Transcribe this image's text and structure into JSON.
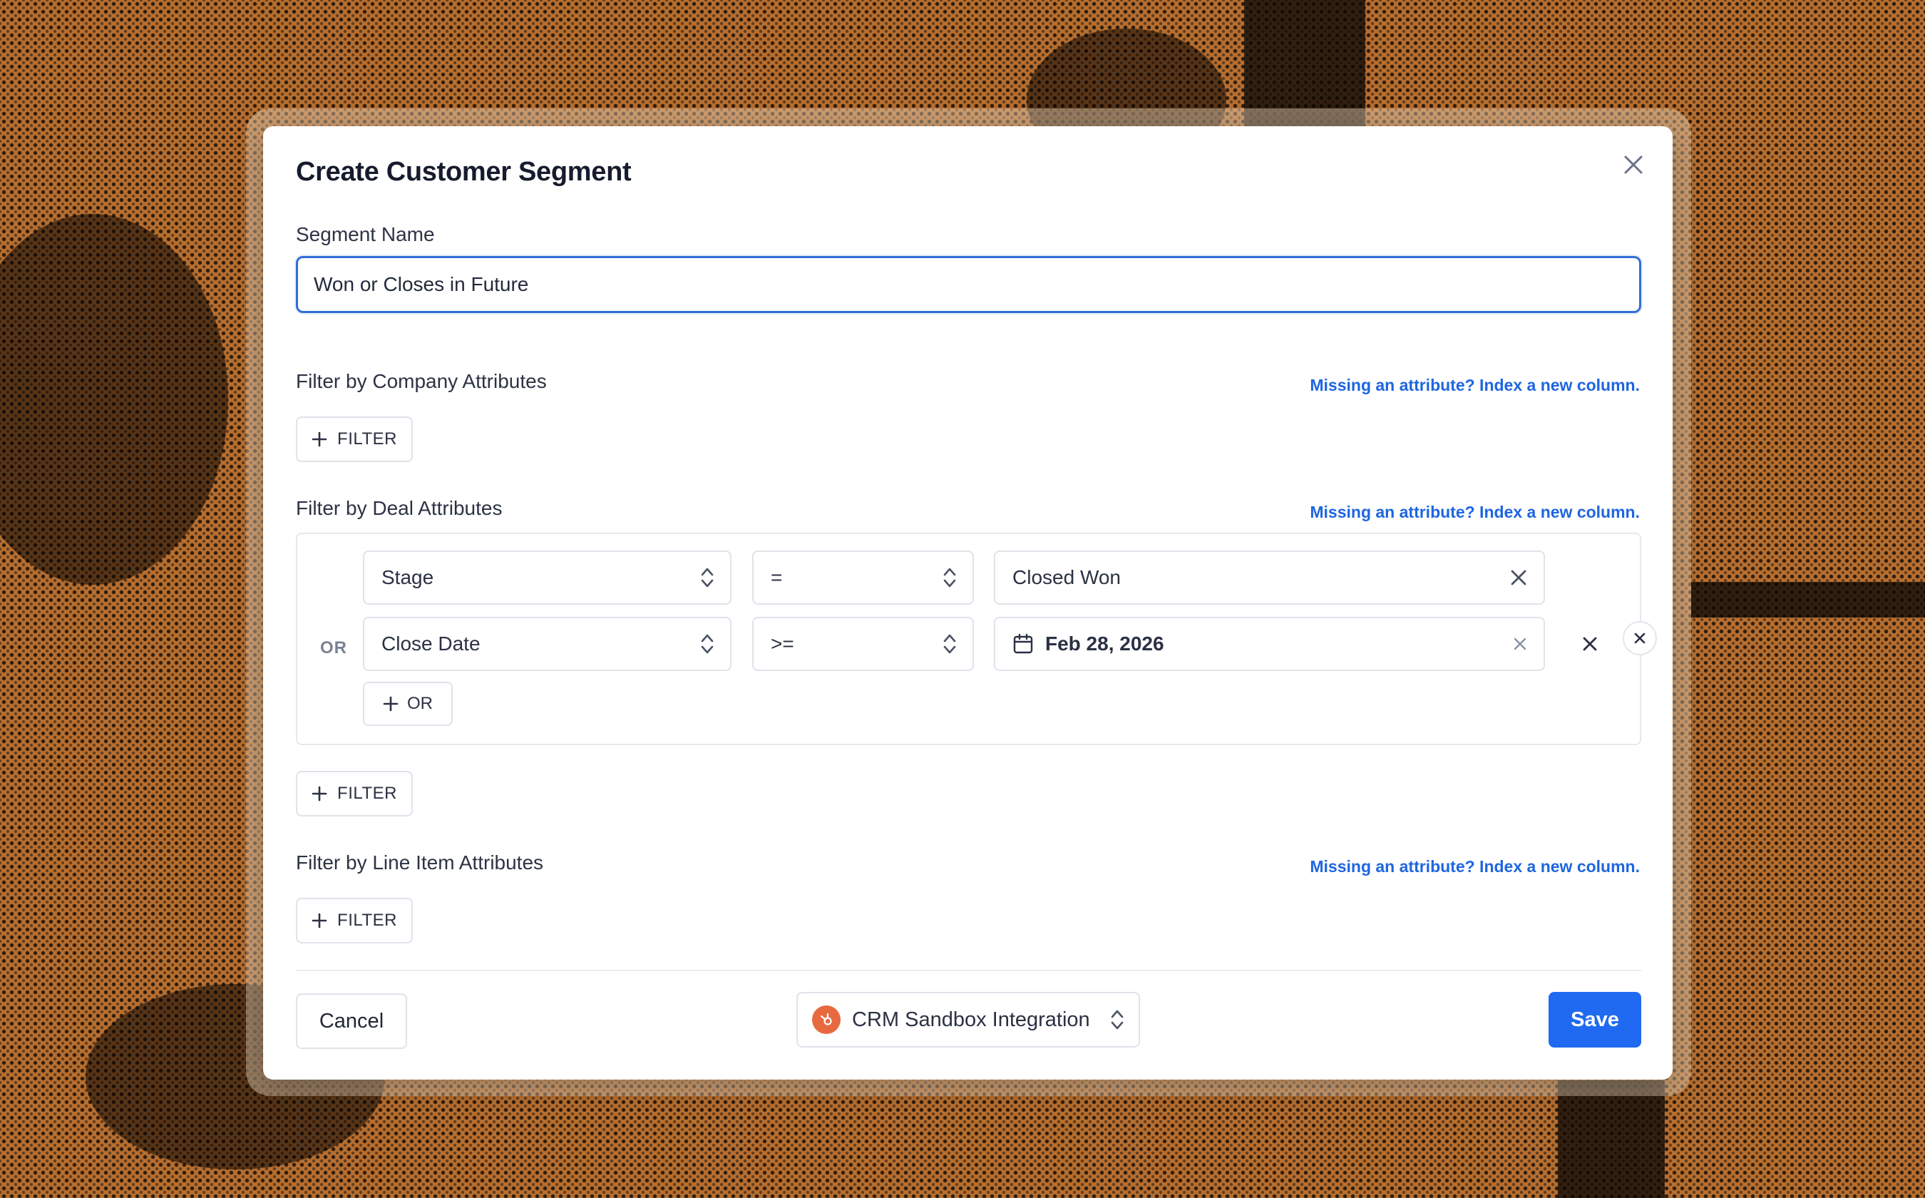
{
  "modal": {
    "title": "Create Customer Segment",
    "segment_name_label": "Segment Name",
    "segment_name_value": "Won or Closes in Future"
  },
  "company_section": {
    "heading": "Filter by Company Attributes",
    "link": "Missing an attribute? Index a new column.",
    "filter_button": "FILTER"
  },
  "deal_section": {
    "heading": "Filter by Deal Attributes",
    "link": "Missing an attribute? Index a new column.",
    "group_connector": "OR",
    "conditions": [
      {
        "field": "Stage",
        "operator": "=",
        "value": "Closed Won",
        "value_icon": ""
      },
      {
        "field": "Close Date",
        "operator": ">=",
        "value": "Feb 28, 2026",
        "value_icon": "calendar-icon"
      }
    ],
    "or_button": "OR",
    "filter_button": "FILTER"
  },
  "line_item_section": {
    "heading": "Filter by Line Item Attributes",
    "link": "Missing an attribute? Index a new column.",
    "filter_button": "FILTER"
  },
  "footer": {
    "cancel": "Cancel",
    "integration": "CRM Sandbox Integration",
    "integration_icon": "hubspot-icon",
    "save": "Save"
  },
  "colors": {
    "accent": "#1f6af0",
    "link": "#1e66e0",
    "integration_brand": "#e8693f",
    "backdrop": "#b86f30"
  }
}
